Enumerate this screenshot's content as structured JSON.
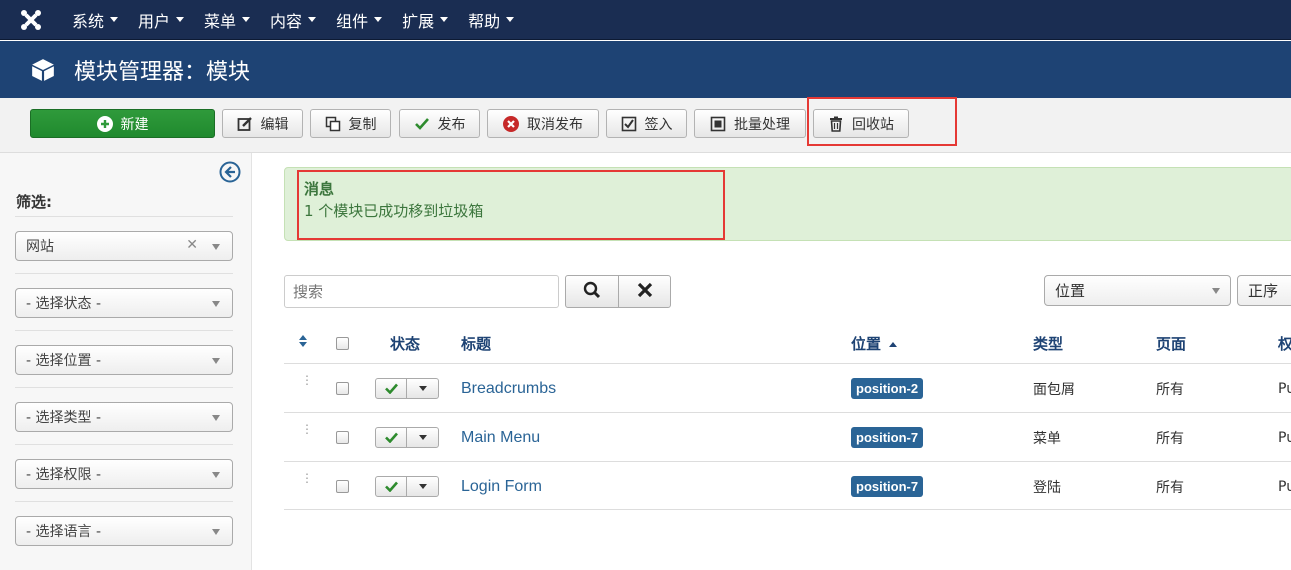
{
  "nav": {
    "items": [
      {
        "label": "系统"
      },
      {
        "label": "用户"
      },
      {
        "label": "菜单"
      },
      {
        "label": "内容"
      },
      {
        "label": "组件"
      },
      {
        "label": "扩展"
      },
      {
        "label": "帮助"
      }
    ]
  },
  "header": {
    "title": "模块管理器：模块"
  },
  "toolbar": {
    "new_label": "新建",
    "edit_label": "编辑",
    "copy_label": "复制",
    "publish_label": "发布",
    "unpublish_label": "取消发布",
    "checkin_label": "签入",
    "batch_label": "批量处理",
    "trash_label": "回收站"
  },
  "sidebar": {
    "title": "筛选:",
    "filters": {
      "site": "网站",
      "state": "- 选择状态 -",
      "position": "- 选择位置 -",
      "type": "- 选择类型 -",
      "access": "- 选择权限 -",
      "language": "- 选择语言 -"
    }
  },
  "message": {
    "heading": "消息",
    "text": "1 个模块已成功移到垃圾箱"
  },
  "search": {
    "placeholder": "搜索"
  },
  "sort": {
    "field": "位置",
    "direction": "正序"
  },
  "table": {
    "headers": {
      "status": "状态",
      "title": "标题",
      "position": "位置",
      "type": "类型",
      "pages": "页面",
      "access": "权"
    },
    "rows": [
      {
        "title": "Breadcrumbs",
        "position": "position-2",
        "type": "面包屑",
        "pages": "所有",
        "access": "Pu"
      },
      {
        "title": "Main Menu",
        "position": "position-7",
        "type": "菜单",
        "pages": "所有",
        "access": "Pu"
      },
      {
        "title": "Login Form",
        "position": "position-7",
        "type": "登陆",
        "pages": "所有",
        "access": "Pu"
      }
    ]
  },
  "colors": {
    "nav_bg": "#1a2d52",
    "header_bg": "#1e4374",
    "new_button": "#2f9a3b",
    "message_bg": "#dff0d8",
    "badge": "#2a6496",
    "highlight_box": "#e53935"
  }
}
